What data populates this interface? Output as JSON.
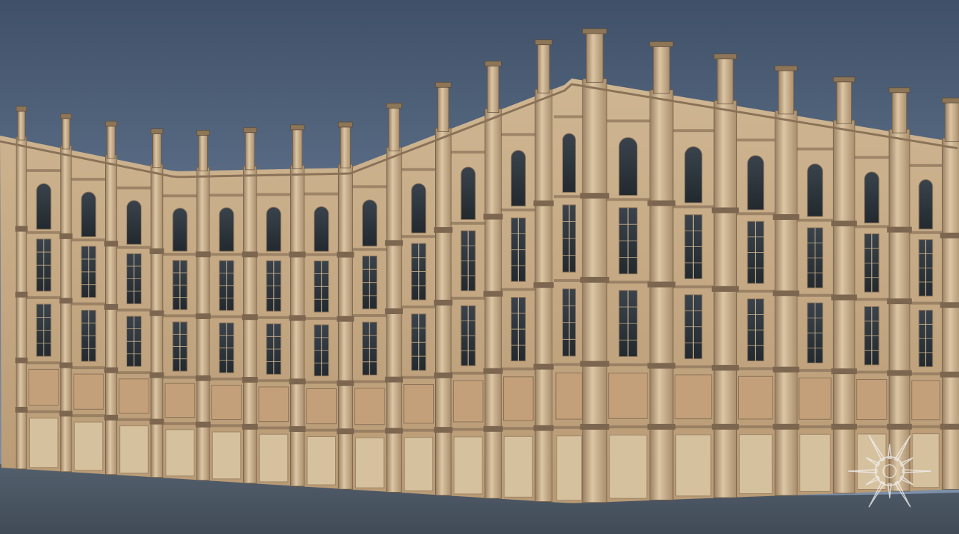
{
  "scene": {
    "subject": "curved-stone-facade-render",
    "sky_color_top": "#3f5068",
    "sky_color_mid": "#6a7d96",
    "sky_color_bottom": "#7f93ab",
    "ground_color": "#4a5564",
    "stone_light": "#d9c2a0",
    "stone_mid": "#c3a67f",
    "stone_dark": "#8a7258",
    "window_color": "#2c343c",
    "mullion_color": "#c9b08b",
    "watermark_icon": "sun-emblem-icon",
    "watermark_color": "#f2f2f2"
  }
}
